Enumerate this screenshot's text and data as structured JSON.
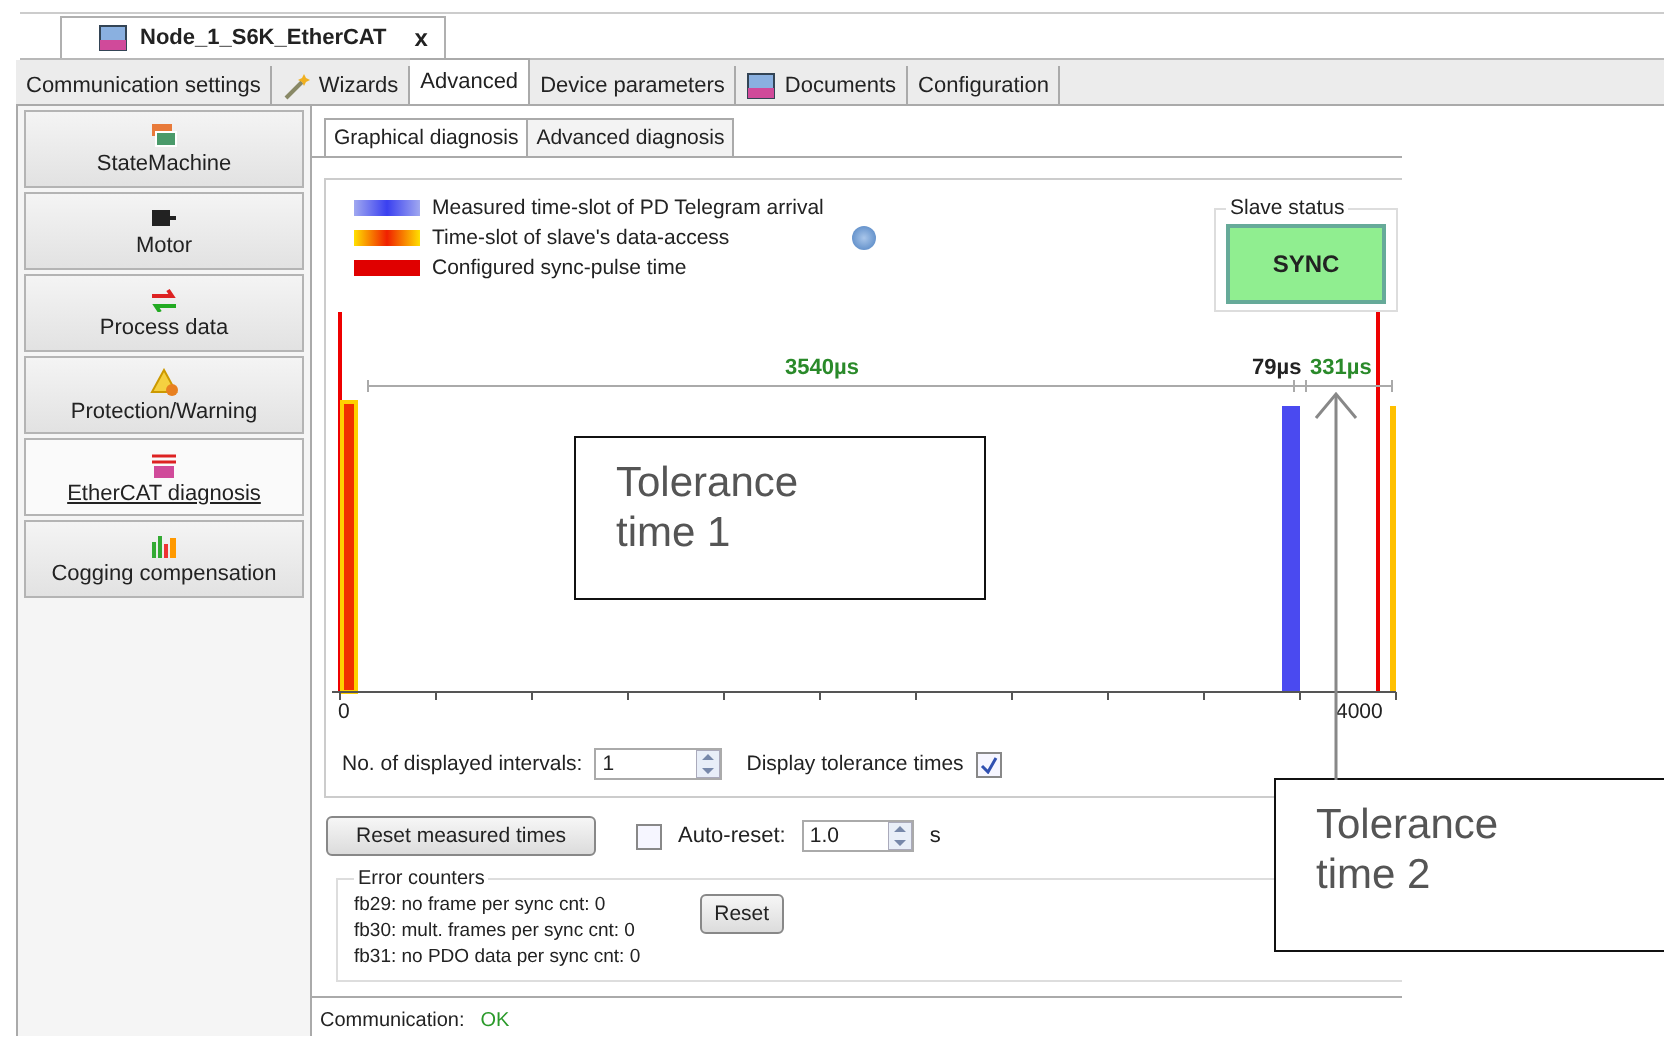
{
  "document_tab": {
    "title": "Node_1_S6K_EtherCAT",
    "close": "x"
  },
  "tabs": [
    {
      "label": "Communication settings",
      "selected": false,
      "kind": "plain"
    },
    {
      "label": "Wizards",
      "selected": false,
      "kind": "wand"
    },
    {
      "label": "Advanced",
      "selected": true,
      "kind": "plain"
    },
    {
      "label": "Device parameters",
      "selected": false,
      "kind": "plain"
    },
    {
      "label": "Documents",
      "selected": false,
      "kind": "book"
    },
    {
      "label": "Configuration",
      "selected": false,
      "kind": "plain"
    }
  ],
  "sidebar": {
    "items": [
      {
        "label": "StateMachine",
        "selected": false,
        "kind": "windows"
      },
      {
        "label": "Motor",
        "selected": false,
        "kind": "motor"
      },
      {
        "label": "Process data",
        "selected": false,
        "kind": "arrows"
      },
      {
        "label": "Protection/Warning",
        "selected": false,
        "kind": "warning"
      },
      {
        "label": "EtherCAT diagnosis",
        "selected": true,
        "kind": "network"
      },
      {
        "label": "Cogging compensation",
        "selected": false,
        "kind": "bars"
      }
    ]
  },
  "subtabs": [
    {
      "label": "Graphical diagnosis",
      "selected": true
    },
    {
      "label": "Advanced diagnosis",
      "selected": false
    }
  ],
  "legend": [
    {
      "label": "Measured time-slot of PD Telegram arrival",
      "kind": "measured"
    },
    {
      "label": "Time-slot of slave's data-access",
      "kind": "access"
    },
    {
      "label": "Configured sync-pulse time",
      "kind": "sync"
    }
  ],
  "slave_status": {
    "title": "Slave status",
    "value": "SYNC"
  },
  "timeline": {
    "interval": "3540µs",
    "tolerance_1": "79µs",
    "tolerance_2": "331µs",
    "axis_start": "0",
    "axis_end": "4000"
  },
  "intervals": {
    "label": "No. of displayed intervals:",
    "value": "1"
  },
  "display_tolerance": {
    "label": "Display tolerance times",
    "checked": true
  },
  "reset_button": "Reset measured times",
  "auto_reset": {
    "label": "Auto-reset:",
    "checked": false,
    "value": "1.0",
    "unit": "s"
  },
  "error_counters": {
    "title": "Error counters",
    "rows": [
      "fb29: no frame per sync cnt: 0",
      "fb30: mult. frames per sync cnt: 0",
      "fb31: no PDO data per sync cnt: 0"
    ],
    "reset": "Reset"
  },
  "communication": {
    "label": "Communication:",
    "value": "OK"
  },
  "callouts": [
    {
      "text": "Tolerance time 1",
      "kind": "plain"
    },
    {
      "text": "Tolerance time 2",
      "kind": "arrow"
    }
  ]
}
